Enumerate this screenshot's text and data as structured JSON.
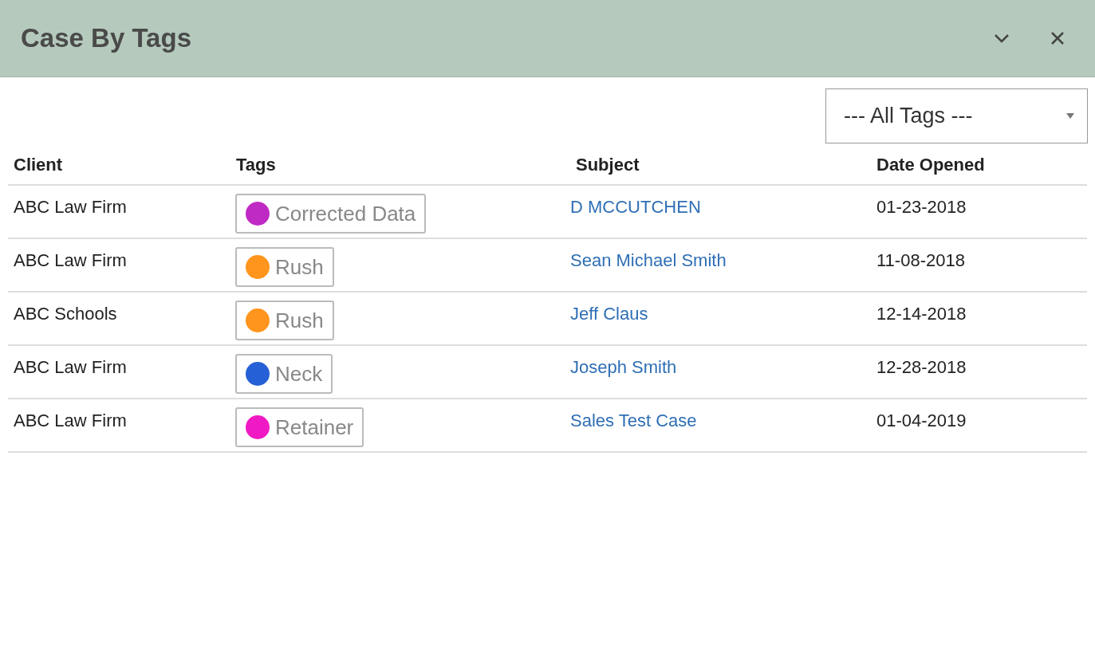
{
  "window": {
    "title": "Case By Tags"
  },
  "filter": {
    "value": "--- All Tags ---"
  },
  "table": {
    "columns": [
      "Client",
      "Tags",
      "Subject",
      "Date Opened"
    ],
    "rows": [
      {
        "client": "ABC Law Firm",
        "tag": {
          "label": "Corrected Data",
          "color": "#c02ac4"
        },
        "subject": "D MCCUTCHEN",
        "date": "01-23-2018"
      },
      {
        "client": "ABC Law Firm",
        "tag": {
          "label": "Rush",
          "color": "#ff951c"
        },
        "subject": "Sean Michael Smith",
        "date": "11-08-2018"
      },
      {
        "client": "ABC Schools",
        "tag": {
          "label": "Rush",
          "color": "#ff951c"
        },
        "subject": "Jeff Claus",
        "date": "12-14-2018"
      },
      {
        "client": "ABC Law Firm",
        "tag": {
          "label": "Neck",
          "color": "#2660d6"
        },
        "subject": "Joseph Smith",
        "date": "12-28-2018"
      },
      {
        "client": "ABC Law Firm",
        "tag": {
          "label": "Retainer",
          "color": "#f01ac4"
        },
        "subject": "Sales Test Case",
        "date": "01-04-2019"
      }
    ]
  }
}
